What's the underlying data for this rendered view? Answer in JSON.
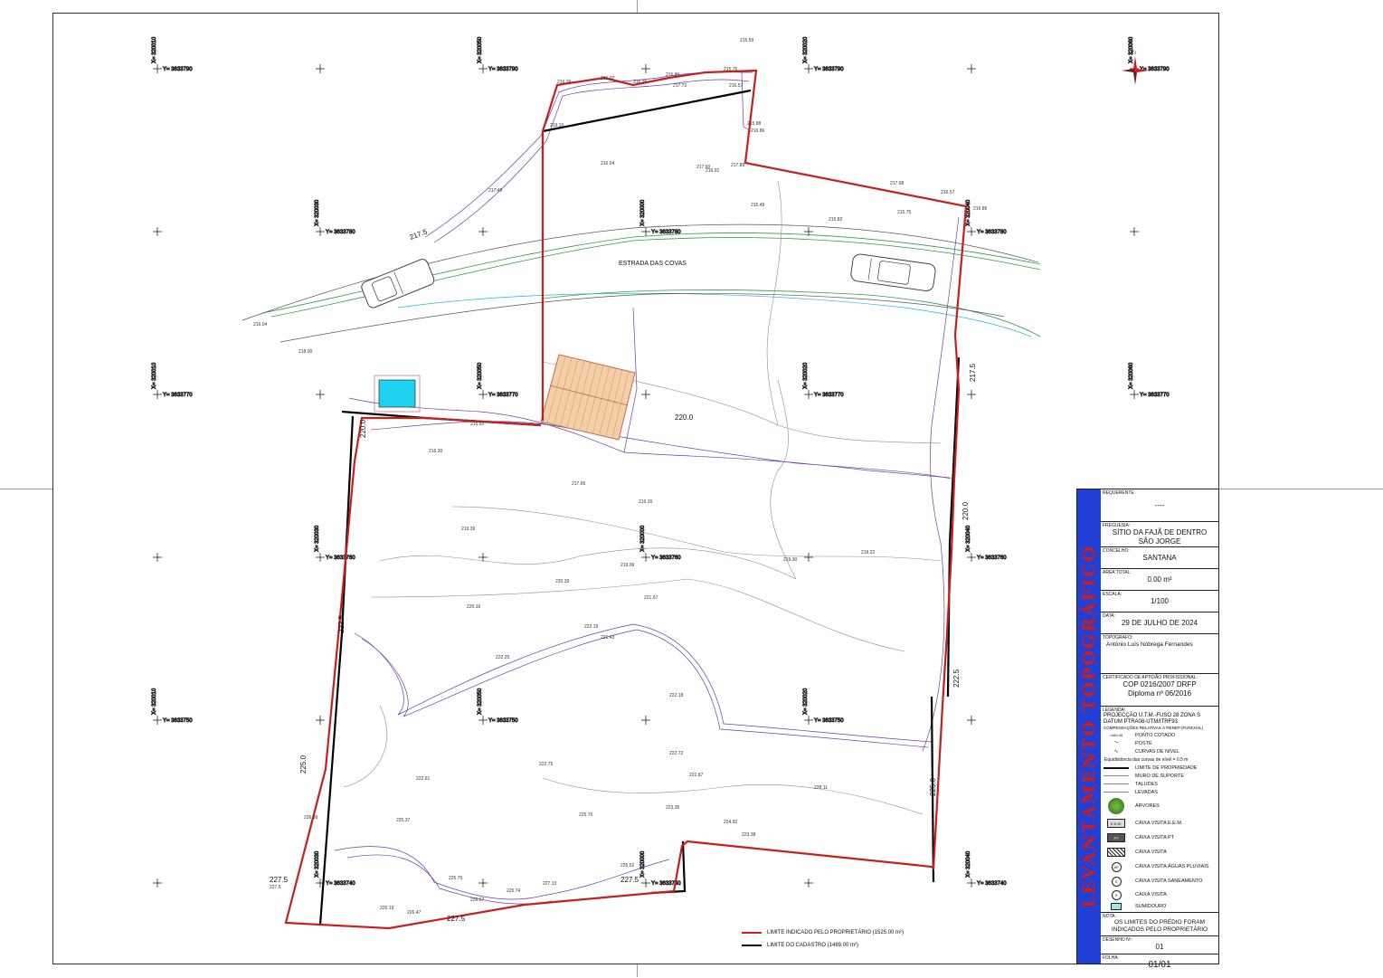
{
  "map": {
    "road_name": "ESTRADA DAS COVAS",
    "contour_labels": [
      "217.5",
      "220.0",
      "222.5",
      "225.0",
      "227.5"
    ],
    "grid_y_labels": [
      "Y= 3633790",
      "Y= 3633780",
      "Y= 3633770",
      "Y= 3633760",
      "Y= 3633750",
      "Y= 3633740"
    ],
    "grid_x_labels": [
      "X= 320010",
      "X= 320030",
      "X= 320050",
      "X= 320000",
      "X= 320020",
      "X= 320040",
      "X= 320060"
    ],
    "spot_heights": [
      "215.59",
      "215.75",
      "215.80",
      "216.02",
      "216.25",
      "217.72",
      "216.57",
      "215.88",
      "216.86",
      "217.60",
      "216.91",
      "216.04",
      "217.89",
      "217.98",
      "216.57",
      "216.86",
      "215.75",
      "215.49",
      "215.82",
      "217.40",
      "219.10",
      "216.39",
      "216.04",
      "218.00",
      "215.92",
      "216.30",
      "217.65",
      "219.26",
      "219.39",
      "219.06",
      "219.22",
      "219.30",
      "220.39",
      "220.16",
      "221.67",
      "222.19",
      "221.43",
      "222.25",
      "222.18",
      "222.61",
      "222.75",
      "222.72",
      "222.87",
      "223.35",
      "224.92",
      "223.38",
      "225.37",
      "225.52",
      "225.76",
      "225.79",
      "226.09",
      "226.19",
      "226.47",
      "226.67",
      "225.74",
      "227.13",
      "228.11",
      "227.5"
    ],
    "colors": {
      "owner_limit": "#c81e1e",
      "cadastre_limit": "#000000",
      "contour": "#6a3fa0",
      "levada": "#2f9b4a",
      "pool": "#1fd2ef"
    }
  },
  "map_legend": {
    "owner_limit": "LIMITE INDICADO PELO PROPRIETÁRIO (1525.00 m²)",
    "cadastre_limit": "LIMITE DO CADASTRO (1489.00 m²)"
  },
  "title_block": {
    "banner": "LEVANTAMENTO TOPOGRÁFICO",
    "requerente_label": "REQUERENTE:",
    "requerente_value": "----",
    "freguesia_label": "FREGUESIA:",
    "freguesia_value_1": "SÍTIO DA FAJÃ DE DENTRO",
    "freguesia_value_2": "SÃO JORGE",
    "concelho_label": "CONCELHO:",
    "concelho_value": "SANTANA",
    "area_label": "AREA TOTAL:",
    "area_value": "0.00 m²",
    "escala_label": "ESCALA:",
    "escala_value": "1/100",
    "data_label": "DATA:",
    "data_value": "29 DE JULHO DE 2024",
    "topografo_label": "TOPOGRAFO:",
    "topografo_value": "António Luís Nóbrega Fernandes",
    "cert_label": "CERTIFICADO DE APTIDÃO PROFISSIONAL:",
    "cert_value": "COP 0216/2007 DRFP",
    "diploma_value": "Diploma nº 06/2016",
    "legenda_label": "LEGENDA:",
    "projection_1": "PROJECÇÃO U.T.M.-FUSO 28 ZONA S",
    "projection_2": "DATUM PTRA08-UTM/ITRF93",
    "projection_3": "COMPENSAÇÕES RELATIVAS À RENEP (FUNCHAL)",
    "legend_items": {
      "ponto_cotado": "PONTO COTADO",
      "poste": "POSTE",
      "curvas": "CURVAS DE NÍVEL",
      "equidistancia": "Equidistância das curvas de nível = 0.5 m",
      "limite": "LIMITE DE PROPRIEDADE",
      "muro": "MURO DE SUPORTE",
      "taludes": "TALUDES",
      "levadas": "LEVADAS",
      "arvores": "ÁRVORES",
      "caixa_eem": "CAIXA VISITA E.E.M.",
      "caixa_pt": "CAIXA VISITA PT",
      "caixa": "CAIXA VISITA",
      "caixa_pluviais": "CAIXA VISITA ÁGUAS PLUVIAIS",
      "caixa_saneamento": "CAIXA VISITA SANEAMENTO",
      "caixa_visita2": "CAIXA VISITA",
      "sumidouro": "SUMIDOURO",
      "ponto_sample": "×484.06",
      "eem_tag": "E.E.M.",
      "pt_tag": "PT",
      "ap_tag": "AP",
      "s_tag": "S"
    },
    "nota_label": "NOTA:",
    "nota_value_1": "OS LIMITES DO PRÉDIO FORAM",
    "nota_value_2": "INDICADOS PELO PROPRIETÁRIO",
    "desenho_label": "DESENHO Nº:",
    "desenho_value": "01",
    "folha_label": "FOLHA:",
    "folha_value": "01/01"
  }
}
